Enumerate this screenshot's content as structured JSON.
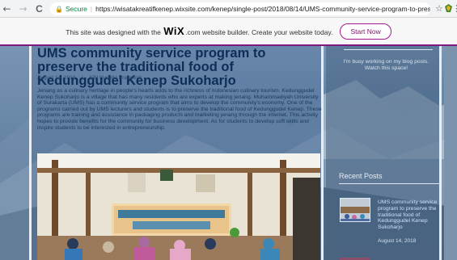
{
  "browser": {
    "nav_back": "←",
    "nav_forward": "→",
    "nav_reload": "C",
    "lock_icon": "🔒",
    "secure_label": "Secure",
    "separator": "|",
    "url": "https://wisatakreatifkenep.wixsite.com/kenep/single-post/2018/08/14/UMS-community-service-program-to-preserve-...",
    "star_icon": "☆",
    "menu_icon": "⋮"
  },
  "wix_banner": {
    "text_before": "This site was designed with the",
    "logo": "WiX",
    "text_after": ".com website builder. Create your website today.",
    "button": "Start Now",
    "accent": "#7a1b7b"
  },
  "post": {
    "title": "UMS community service program to preserve the traditional food of Kedunggudel Kenep Sukoharjo",
    "date": "August 14, 2018",
    "divider": "|",
    "author": "KBI Nurjulia Prasewati",
    "body": "Jenang as a culinary heritage in people's hearts adds to the richness of Indonesian culinary tourism. Kedunggudel Kenep Sukoharjo is a village that has many residents who are experts at making jenang. Muhammadiyah University of Surakarta (UMS) has a community service program that aims to develop the community's economy. One of the programs carried out by UMS lecturers and students is to preserve the traditional food of Kedunggudel Kenep. These programs are training and assistance in packaging products and marketing jenang through the internet. This activity hopes to provide benefits for the community for business development. As for students to develop soft skills and inspire students to be interested in entrepreneurship."
  },
  "sidebar": {
    "note": "I'm busy working on my blog posts. Watch this space!",
    "recent_title": "Recent Posts",
    "recent_link": "UMS community service program to preserve the traditional food of Kedunggudel Kenep Sukoharjo",
    "recent_date": "August 14, 2018"
  }
}
